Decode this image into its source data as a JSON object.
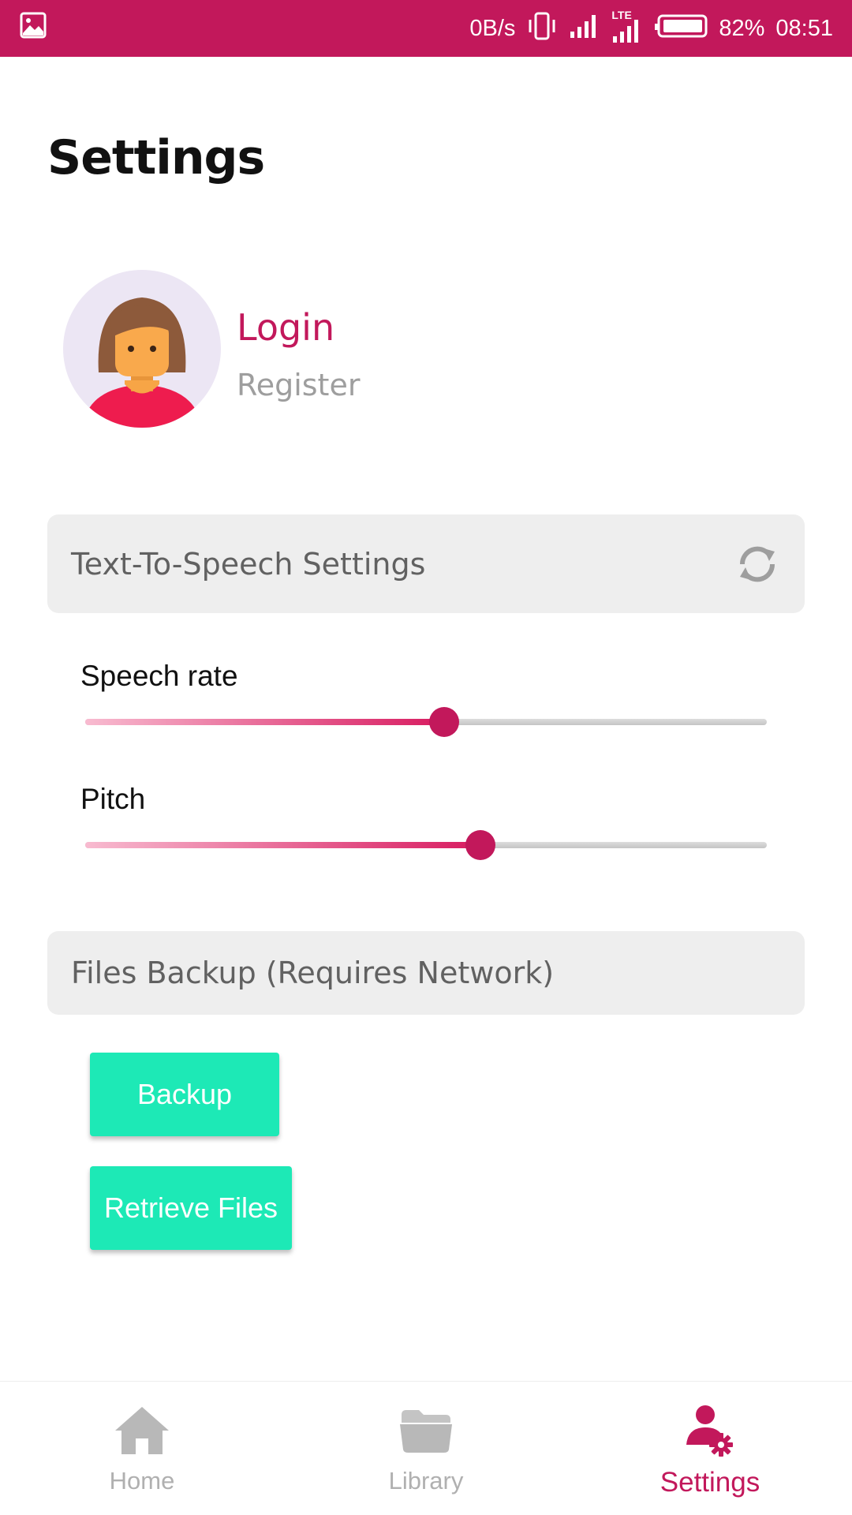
{
  "status_bar": {
    "left_icon": "image-icon",
    "net_speed": "0B/s",
    "battery_percent": "82%",
    "time": "08:51",
    "signal_label": "LTE",
    "background_color": "#c2185b"
  },
  "page": {
    "title": "Settings"
  },
  "profile": {
    "login_label": "Login",
    "register_label": "Register",
    "avatar_icon": "female-avatar-icon"
  },
  "tts_section": {
    "header": "Text-To-Speech Settings",
    "reset_icon": "refresh-icon",
    "speech_rate": {
      "label": "Speech rate",
      "value": 0.527
    },
    "pitch": {
      "label": "Pitch",
      "value": 0.58
    }
  },
  "backup_section": {
    "header": "Files Backup (Requires Network)",
    "backup_label": "Backup",
    "retrieve_label": "Retrieve Files",
    "button_color": "#1de9b6"
  },
  "bottom_nav": {
    "items": [
      {
        "label": "Home",
        "icon": "home-icon",
        "active": false
      },
      {
        "label": "Library",
        "icon": "folder-icon",
        "active": false
      },
      {
        "label": "Settings",
        "icon": "user-settings-icon",
        "active": true
      }
    ],
    "active_color": "#c2185b",
    "inactive_color": "#b0b0b0"
  }
}
